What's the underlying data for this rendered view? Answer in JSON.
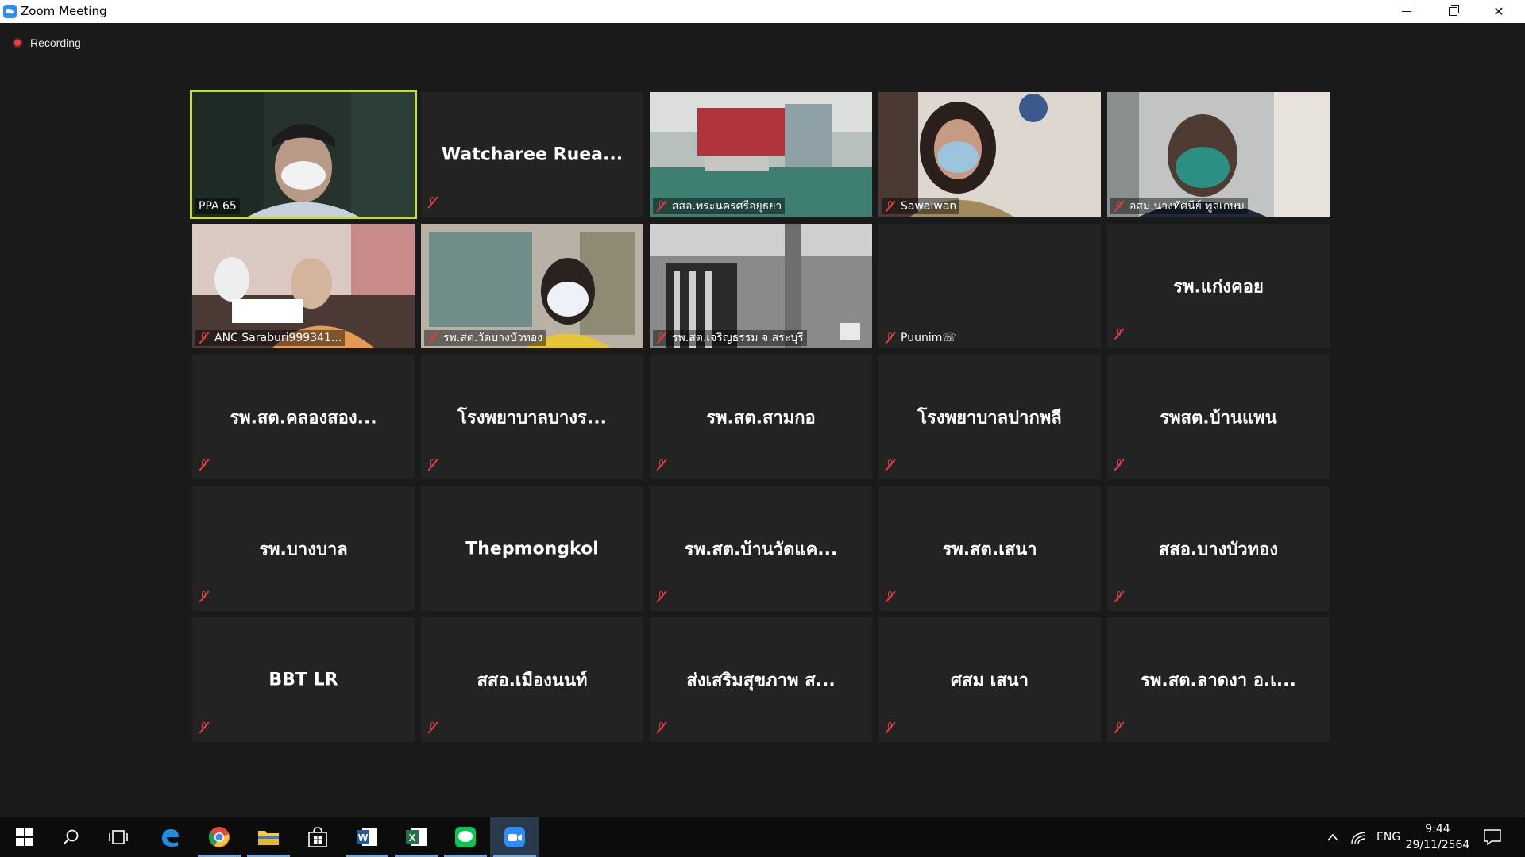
{
  "window": {
    "title": "Zoom Meeting"
  },
  "recording": {
    "label": "Recording"
  },
  "participants": [
    {
      "name": "PPA 65",
      "video": true,
      "active_speaker": true,
      "muted": false
    },
    {
      "name": "Watcharee  Ruea...",
      "video": false,
      "muted": true
    },
    {
      "name": "สสอ.พระนครศรีอยุธยา",
      "video": true,
      "muted": true
    },
    {
      "name": "Sawaiwan",
      "video": true,
      "muted": true
    },
    {
      "name": "อสม.นางทัศนีย์ พูลเกษม",
      "video": true,
      "muted": true
    },
    {
      "name": "ANC Saraburi999341...",
      "video": true,
      "muted": true
    },
    {
      "name": "รพ.สต.วัดบางบัวทอง",
      "video": true,
      "muted": true
    },
    {
      "name": "รพ.สต.เจริญธรรม จ.สระบุรี",
      "video": true,
      "muted": true
    },
    {
      "name": "Puunim☏",
      "video": false,
      "show_label": true,
      "muted": true
    },
    {
      "name": "รพ.แก่งคอย",
      "video": false,
      "muted": true
    },
    {
      "name": "รพ.สต.คลองสอง...",
      "video": false,
      "muted": true
    },
    {
      "name": "โรงพยาบาลบางร...",
      "video": false,
      "muted": true
    },
    {
      "name": "รพ.สต.สามกอ",
      "video": false,
      "muted": true
    },
    {
      "name": "โรงพยาบาลปากพลี",
      "video": false,
      "muted": true
    },
    {
      "name": "รพสต.บ้านแพน",
      "video": false,
      "muted": true
    },
    {
      "name": "รพ.บางบาล",
      "video": false,
      "muted": true
    },
    {
      "name": "Thepmongkol",
      "video": false,
      "muted": false
    },
    {
      "name": "รพ.สต.บ้านวัดแค...",
      "video": false,
      "muted": true
    },
    {
      "name": "รพ.สต.เสนา",
      "video": false,
      "muted": true
    },
    {
      "name": "สสอ.บางบัวทอง",
      "video": false,
      "muted": true
    },
    {
      "name": "BBT LR",
      "video": false,
      "muted": true
    },
    {
      "name": "สสอ.เมืองนนท์",
      "video": false,
      "muted": true
    },
    {
      "name": "ส่งเสริมสุขภาพ ส...",
      "video": false,
      "muted": true
    },
    {
      "name": "ศสม เสนา",
      "video": false,
      "muted": true
    },
    {
      "name": "รพ.สต.ลาดงา อ.เ...",
      "video": false,
      "muted": true
    }
  ],
  "taskbar": {
    "apps": [
      "windows-start",
      "search",
      "task-view",
      "edge",
      "chrome",
      "file-explorer",
      "store",
      "word",
      "excel",
      "line",
      "zoom"
    ],
    "language": "ENG",
    "time": "9:44",
    "date": "29/11/2564"
  },
  "colors": {
    "background": "#1a1a1a",
    "tile": "#232323",
    "active_speaker_border": "#c4dc3c",
    "mute_red": "#e23b3b",
    "recording_red": "#ea3e3e"
  }
}
